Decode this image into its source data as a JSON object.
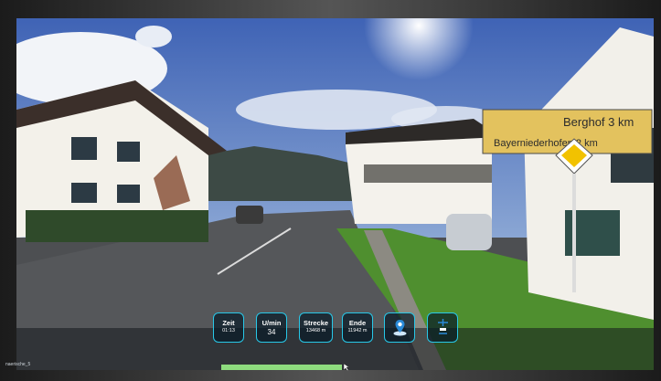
{
  "app": {
    "route_name": "naerische_5"
  },
  "video": {
    "sign_line1": "Berghof 3 km",
    "sign_line2": "Bayerniederhofen 2 km"
  },
  "hud": {
    "tiles": [
      {
        "label": "Zeit",
        "value": "01:13"
      },
      {
        "label": "U/min",
        "value": "34"
      },
      {
        "label": "Strecke",
        "value": "13468 m"
      },
      {
        "label": "Ende",
        "value": "11942 m"
      }
    ],
    "icons": [
      "map-pin-icon",
      "bike-settings-icon"
    ]
  },
  "progress": {
    "fraction": 0.34
  },
  "colors": {
    "accent": "#28c8e8",
    "progress": "#8edc7e"
  }
}
